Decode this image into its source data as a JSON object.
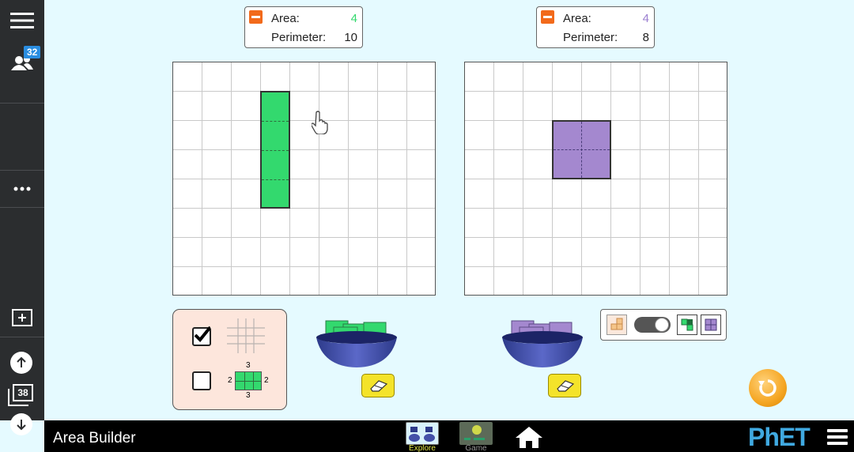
{
  "sidebar": {
    "participants_count": "32",
    "slide_count": "38",
    "icons": [
      "hamburger-icon",
      "participants-icon",
      "more-icon",
      "add-slide-icon",
      "arrow-up-icon",
      "slides-icon",
      "arrow-down-icon"
    ]
  },
  "left_readout": {
    "area_label": "Area:",
    "area_value": "4",
    "perimeter_label": "Perimeter:",
    "perimeter_value": "10",
    "area_color": "#33d96e"
  },
  "right_readout": {
    "area_label": "Area:",
    "area_value": "4",
    "perimeter_label": "Perimeter:",
    "perimeter_value": "8",
    "area_color": "#9b7fd0"
  },
  "control_panel": {
    "grid_checkbox_checked": true,
    "dimensions_checkbox_checked": false,
    "dim_top": "3",
    "dim_bottom": "3",
    "dim_left": "2",
    "dim_right": "2"
  },
  "colors": {
    "green": "#33d96e",
    "purple": "#a488cf",
    "background": "#e5faff",
    "reset": "#f5a623"
  },
  "navbar": {
    "title": "Area Builder",
    "tabs": [
      {
        "label": "Explore",
        "active": true
      },
      {
        "label": "Game",
        "active": false
      }
    ],
    "logo": "PhET"
  }
}
